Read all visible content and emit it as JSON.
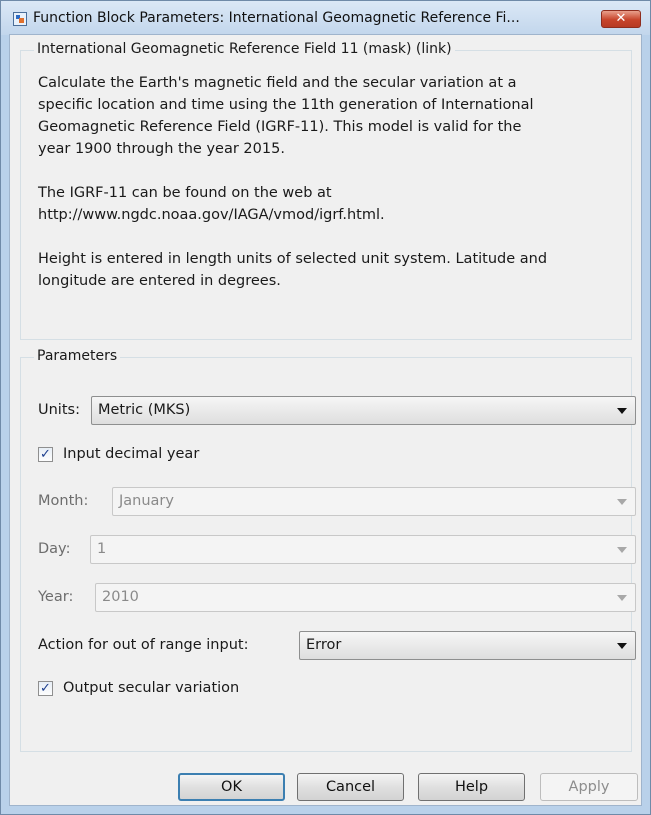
{
  "window": {
    "title": "Function Block Parameters: International Geomagnetic Reference Fi...",
    "close_glyph": "✕"
  },
  "description": {
    "group_title": "International Geomagnetic Reference Field 11 (mask) (link)",
    "para1": [
      "Calculate the Earth's magnetic field and the secular variation at a",
      "specific location and time using the 11th generation of International",
      "Geomagnetic Reference Field (IGRF-11).  This model is valid for the",
      "year 1900 through the year 2015."
    ],
    "para2": [
      "The IGRF-11 can be found on the web at",
      "http://www.ngdc.noaa.gov/IAGA/vmod/igrf.html."
    ],
    "para3": [
      "Height is entered in length units of selected unit system. Latitude and",
      "longitude are entered in degrees."
    ]
  },
  "parameters": {
    "group_title": "Parameters",
    "units": {
      "label": "Units:",
      "value": "Metric (MKS)"
    },
    "input_decimal_year": {
      "label": "Input decimal year",
      "checked": true
    },
    "month": {
      "label": "Month:",
      "value": "January",
      "enabled": false
    },
    "day": {
      "label": "Day:",
      "value": "1",
      "enabled": false
    },
    "year": {
      "label": "Year:",
      "value": "2010",
      "enabled": false
    },
    "action": {
      "label": "Action for out of range input:",
      "value": "Error"
    },
    "output_secular": {
      "label": "Output secular variation",
      "checked": true
    }
  },
  "buttons": {
    "ok": "OK",
    "cancel": "Cancel",
    "help": "Help",
    "apply": "Apply"
  },
  "check_glyph": "✓"
}
